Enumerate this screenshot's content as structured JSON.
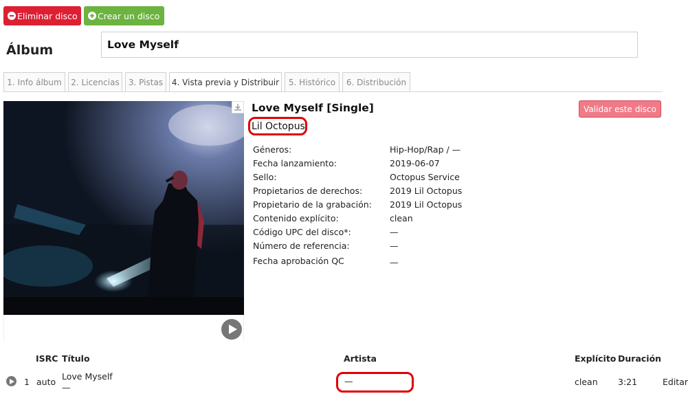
{
  "toolbar": {
    "delete_label": "Eliminar disco",
    "create_label": "Crear un disco"
  },
  "album": {
    "label": "Álbum",
    "title_value": "Love Myself"
  },
  "tabs": [
    {
      "label": "1. Info álbum"
    },
    {
      "label": "2. Licencias"
    },
    {
      "label": "3. Pistas"
    },
    {
      "label": "4. Vista previa y Distribuir"
    },
    {
      "label": "5. Histórico"
    },
    {
      "label": "6. Distribución"
    }
  ],
  "release": {
    "title": "Love Myself [Single]",
    "artist": "Lil Octopus",
    "validate_label": "Validar este disco",
    "details": [
      {
        "label": "Géneros:",
        "value": "Hip-Hop/Rap / —"
      },
      {
        "label": "Fecha lanzamiento:",
        "value": "2019-06-07"
      },
      {
        "label": "Sello:",
        "value": "Octopus Service"
      },
      {
        "label": "Propietarios de derechos:",
        "value": "2019 Lil Octopus"
      },
      {
        "label": "Propietario de la grabación:",
        "value": "2019 Lil Octopus"
      },
      {
        "label": "Contenido explícito:",
        "value": "clean"
      },
      {
        "label": "Código UPC del disco*:",
        "value": "—"
      },
      {
        "label": "Número de referencia:",
        "value": "—"
      },
      {
        "label": "Fecha aprobación QC",
        "value": "—"
      }
    ]
  },
  "tracks": {
    "headers": {
      "isrc": "ISRC",
      "title": "Título",
      "artist": "Artista",
      "explicit": "Explícito",
      "duration": "Duración"
    },
    "rows": [
      {
        "number": "1",
        "isrc": "auto",
        "title": "Love Myself",
        "subtitle": "—",
        "artist": "—",
        "explicit": "clean",
        "duration": "3:21",
        "edit_label": "Editar"
      }
    ]
  },
  "colors": {
    "delete": "#dd1f34",
    "create": "#6cb33f",
    "validate": "#f07a88",
    "highlight": "#e00000"
  },
  "icons": [
    "minus-circle-icon",
    "plus-circle-icon",
    "download-icon",
    "play-icon"
  ]
}
